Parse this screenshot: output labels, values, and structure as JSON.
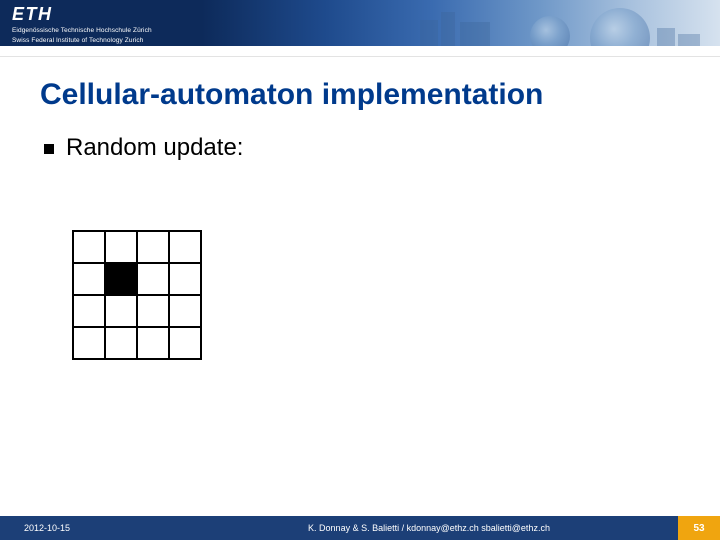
{
  "header": {
    "logo_main": "ETH",
    "logo_sub_line1": "Eidgenössische Technische Hochschule Zürich",
    "logo_sub_line2": "Swiss Federal Institute of Technology Zurich"
  },
  "title": "Cellular-automaton implementation",
  "bullet": "Random update:",
  "grid": {
    "rows": 4,
    "cols": 4,
    "filled": [
      [
        1,
        1
      ]
    ]
  },
  "footer": {
    "date": "2012-10-15",
    "credit": "K. Donnay & S. Balietti / kdonnay@ethz.ch   sbalietti@ethz.ch",
    "page": "53"
  }
}
